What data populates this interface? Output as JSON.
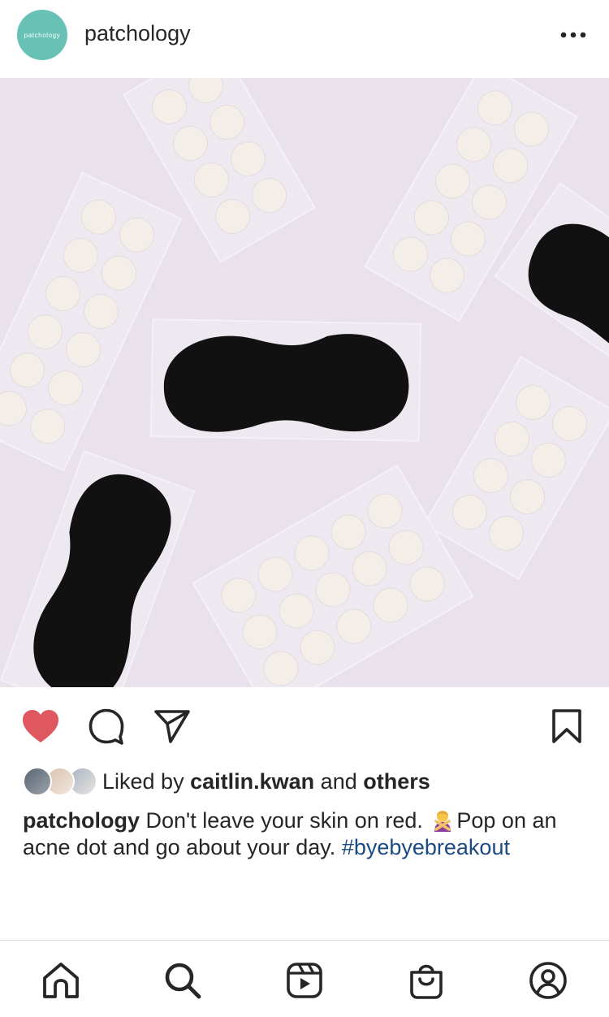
{
  "post": {
    "account": {
      "username": "patchology",
      "avatar_text": "patchology",
      "avatar_color": "#67c2b5"
    },
    "menu_icon": "more-horizontal-icon",
    "image": {
      "description_colors": {
        "background": "#e9e1ec",
        "patch_black": "#111111",
        "dot": "#f3eee8"
      }
    },
    "actions": {
      "like_icon": "heart-filled-icon",
      "like_color": "#e0585f",
      "comment_icon": "comment-icon",
      "share_icon": "send-icon",
      "save_icon": "bookmark-icon"
    },
    "likes": {
      "prefix": "Liked by",
      "user": "caitlin.kwan",
      "connector": "and",
      "others": "others"
    },
    "caption": {
      "username": "patchology",
      "text": "Don't leave your skin on red.",
      "emoji_icon": "person-gesturing-no-emoji",
      "text2": "Pop on an acne dot and go about your day.",
      "hashtag": "#byebyebreakout",
      "hashtag_color": "#1c4a83"
    }
  },
  "tabbar": {
    "items": [
      {
        "icon": "home-icon"
      },
      {
        "icon": "search-icon"
      },
      {
        "icon": "reels-icon"
      },
      {
        "icon": "shop-icon"
      },
      {
        "icon": "profile-icon"
      }
    ]
  }
}
